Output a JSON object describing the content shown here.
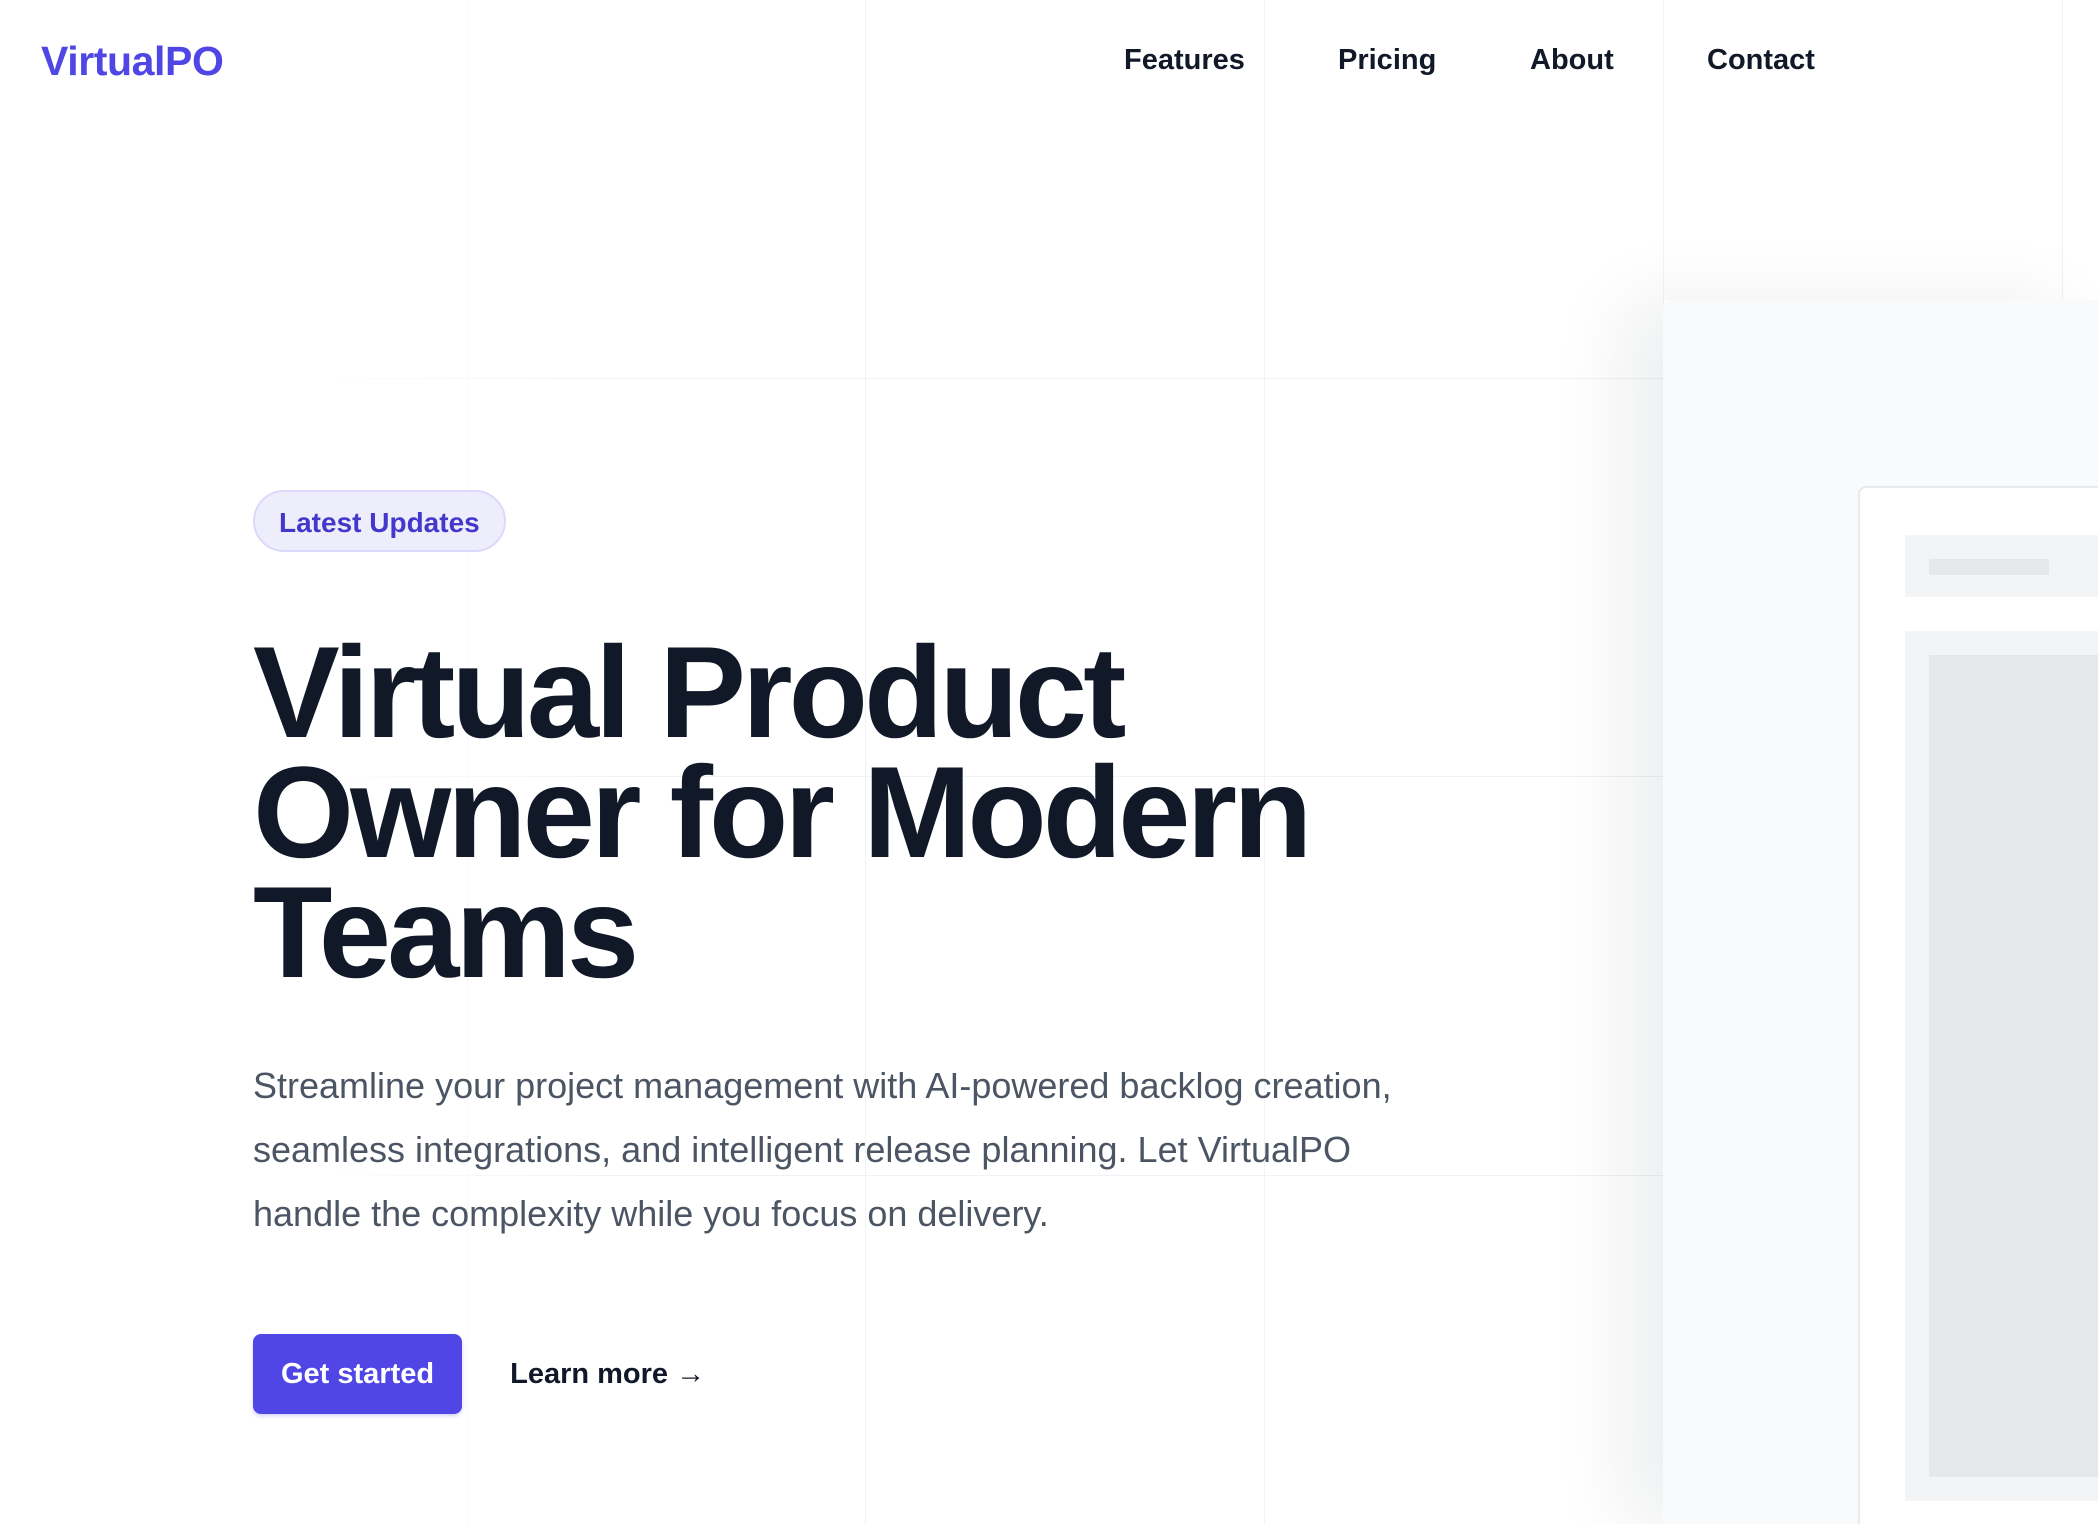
{
  "brand": {
    "name": "VirtualPO",
    "accent_color": "#4f46e5"
  },
  "nav": {
    "items": [
      {
        "label": "Features"
      },
      {
        "label": "Pricing"
      },
      {
        "label": "About"
      },
      {
        "label": "Contact"
      }
    ]
  },
  "hero": {
    "badge": "Latest Updates",
    "headline": "Virtual Product Owner for Modern Teams",
    "lead": "Streamline your project management with AI-powered backlog creation, seamless integrations, and intelligent release planning. Let VirtualPO handle the complexity while you focus on delivery.",
    "primary_cta": "Get started",
    "secondary_cta": "Learn more",
    "secondary_cta_icon": "arrow-right-icon",
    "secondary_cta_glyph": "→"
  },
  "colors": {
    "heading": "#111827",
    "body_text": "#4b5563",
    "badge_bg": "#eeedfc",
    "badge_text": "#4338ca"
  }
}
